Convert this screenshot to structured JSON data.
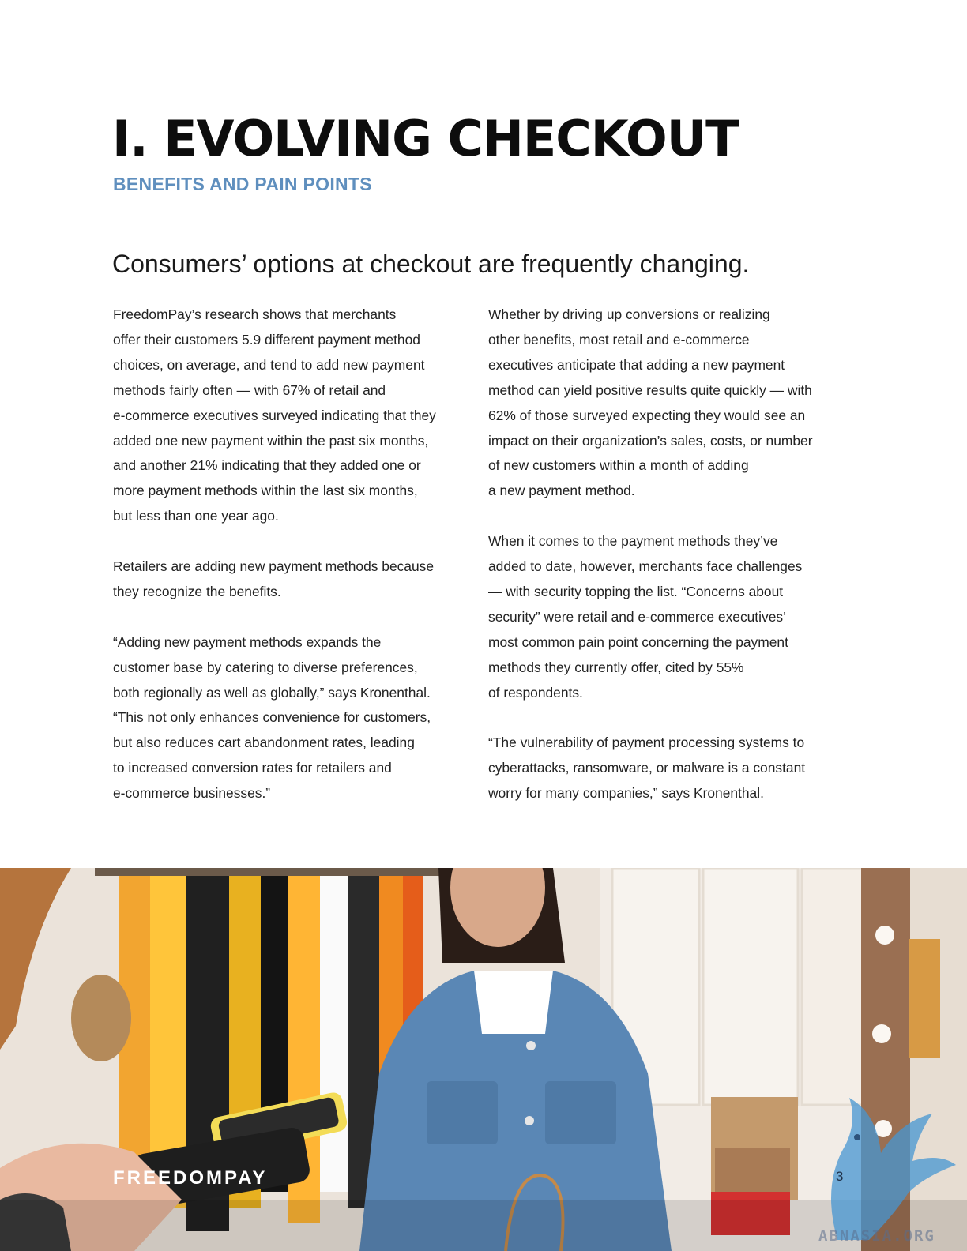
{
  "heading": {
    "title": "I. EVOLVING CHECKOUT",
    "subtitle": "BENEFITS AND PAIN POINTS",
    "lead": "Consumers’ options at checkout are frequently changing."
  },
  "left_column": {
    "p1": "FreedomPay’s research shows that merchants\noffer their customers 5.9 different payment method\nchoices, on average, and tend to add new payment\nmethods fairly often — with 67% of retail and\ne-commerce executives surveyed indicating that they\nadded one new payment within the past six months,\nand another 21% indicating that they added one or\nmore payment methods within the last six months,\nbut less than one year ago.",
    "p2": "Retailers are adding new payment methods because\nthey recognize the benefits.",
    "p3": "“Adding new payment methods expands the\ncustomer base by catering to diverse preferences,\nboth regionally as well as globally,” says Kronenthal.\n“This not only enhances convenience for customers,\nbut also reduces cart abandonment rates,  leading\nto increased conversion rates for retailers and\ne-commerce businesses.”"
  },
  "right_column": {
    "p1": "Whether by driving up conversions or realizing\nother benefits, most retail and e-commerce\nexecutives anticipate that adding a new payment\nmethod can yield positive results quite quickly — with\n62% of those surveyed expecting they would see an\nimpact on their organization’s sales, costs, or number\nof new customers within a month of adding\na new payment method.",
    "p2": "When it comes to the payment methods they’ve\nadded to date, however, merchants face challenges\n— with security topping the list. “Concerns about\nsecurity” were retail and e-commerce executives’\nmost common pain point concerning the payment\nmethods they currently offer, cited by 55%\nof respondents.",
    "p3": "“The vulnerability of payment processing systems to\ncyberattacks, ransomware, or malware is a constant\nworry for many companies,” says Kronenthal."
  },
  "footer": {
    "logo": "FREEDOMPAY",
    "page_number": "3",
    "watermark": "ABNASIA.ORG"
  },
  "colors": {
    "subtitle": "#5f8fbe",
    "title": "#0d0d0d",
    "body_text": "#222222"
  }
}
